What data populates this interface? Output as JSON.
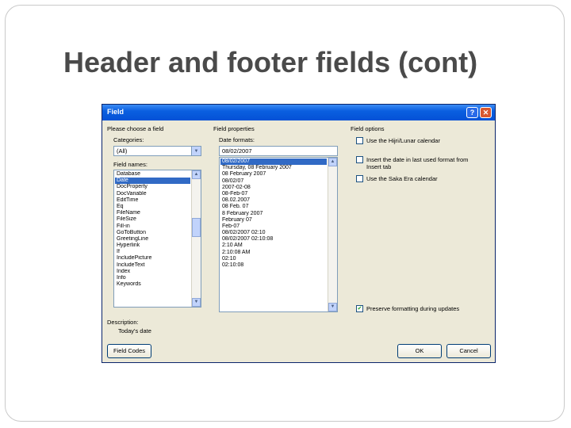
{
  "slide": {
    "title": "Header and footer fields (cont)"
  },
  "dialog": {
    "title": "Field",
    "help_glyph": "?",
    "close_glyph": "✕",
    "choose_field_label": "Please choose a field",
    "categories_label": "Categories:",
    "category_value": "(All)",
    "field_names_label": "Field names:",
    "field_names": [
      "Database",
      "Date",
      "DocProperty",
      "DocVariable",
      "EditTime",
      "Eq",
      "FileName",
      "FileSize",
      "Fill-in",
      "GoToButton",
      "GreetingLine",
      "Hyperlink",
      "If",
      "IncludePicture",
      "IncludeText",
      "Index",
      "Info",
      "Keywords"
    ],
    "field_names_selected": 1,
    "field_properties_label": "Field properties",
    "date_formats_label": "Date formats:",
    "date_format_value": "08/02/2007",
    "date_formats": [
      "08/02/2007",
      "Thursday, 08 February 2007",
      "08 February 2007",
      "08/02/07",
      "2007-02-08",
      "08-Feb-07",
      "08.02.2007",
      "08 Feb. 07",
      "8 February 2007",
      "February 07",
      "Feb-07",
      "08/02/2007 02:10",
      "08/02/2007 02:10:08",
      "2:10 AM",
      "2:10:08 AM",
      "02:10",
      "02:10:08"
    ],
    "date_formats_selected": 0,
    "field_options_label": "Field options",
    "options": [
      {
        "label": "Use the Hijri/Lunar calendar",
        "checked": false
      },
      {
        "label": "Insert the date in last used format from Insert tab",
        "checked": false
      },
      {
        "label": "Use the Saka Era calendar",
        "checked": false
      }
    ],
    "preserve": {
      "label": "Preserve formatting during updates",
      "checked": true,
      "mark": "✔"
    },
    "description_label": "Description:",
    "description_text": "Today's date",
    "field_codes_button": "Field Codes",
    "ok_button": "OK",
    "cancel_button": "Cancel",
    "scroll_up_glyph": "▲",
    "scroll_down_glyph": "▼",
    "combo_arrow_glyph": "▼"
  }
}
